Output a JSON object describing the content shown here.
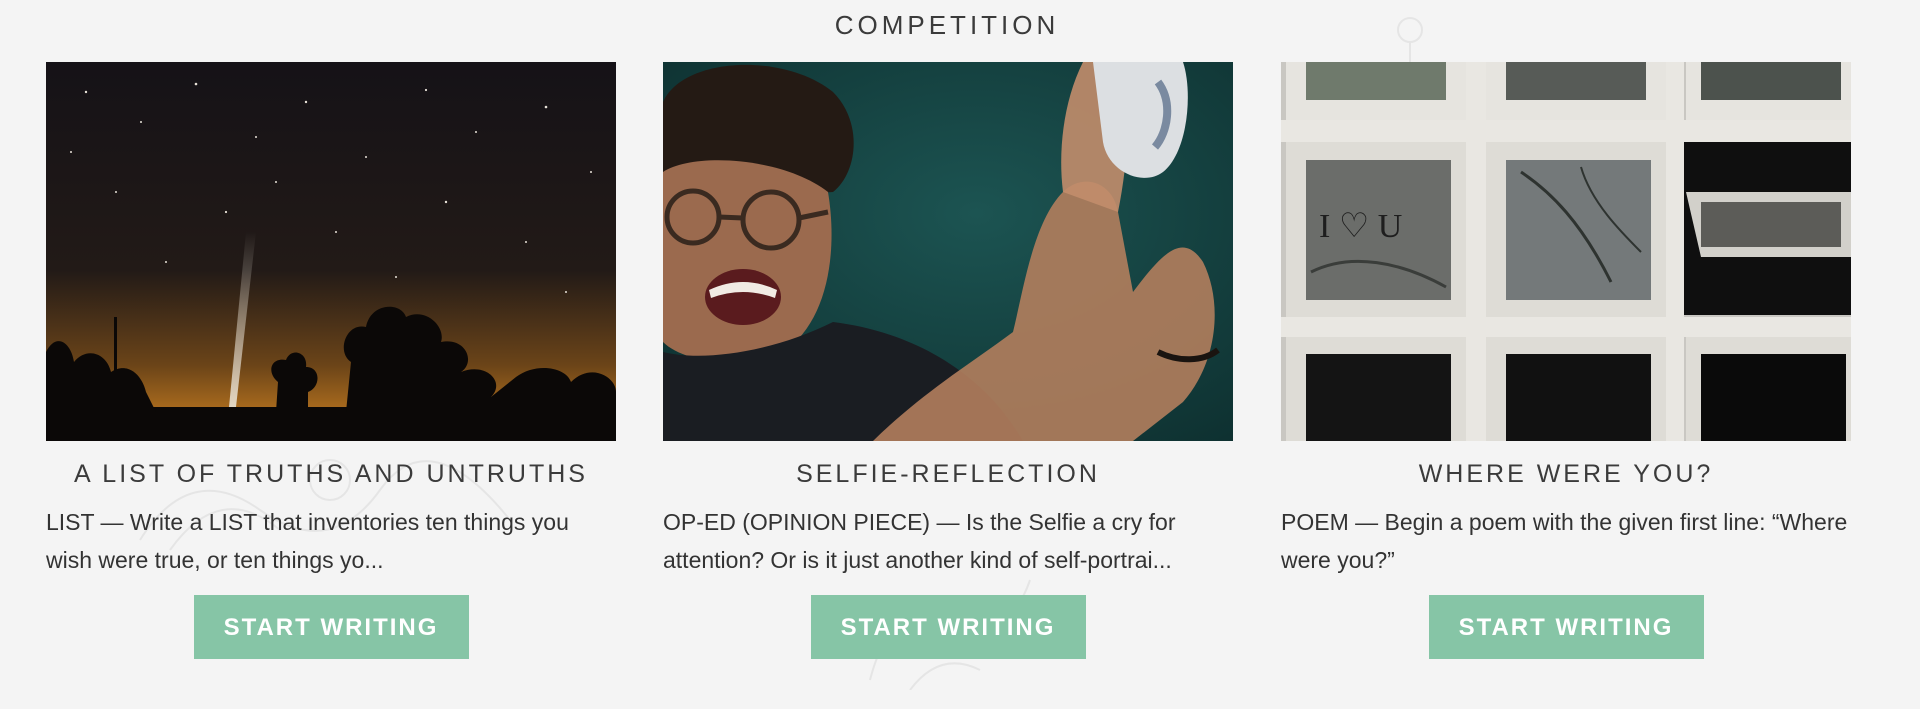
{
  "section": {
    "title": "COMPETITION"
  },
  "cards": [
    {
      "title": "A LIST OF TRUTHS AND UNTRUTHS",
      "description": "LIST — Write a LIST that inventories ten things you wish were true, or ten things yo...",
      "button_label": "START WRITING",
      "image": "night-sky-trees-photo"
    },
    {
      "title": "SELFIE-REFLECTION",
      "description": "OP-ED (OPINION PIECE) — Is the Selfie a cry for attention? Or is it just another kind of self-portrai...",
      "button_label": "START WRITING",
      "image": "selfie-person-photo"
    },
    {
      "title": "WHERE WERE YOU?",
      "description": "POEM — Begin a poem with the given first line: “Where were you?”",
      "button_label": "START WRITING",
      "image": "window-grid-photo",
      "image_text": "I ♡ U"
    }
  ],
  "colors": {
    "accent": "#86c5a6",
    "background": "#f4f4f4",
    "text": "#3b3b3b"
  }
}
